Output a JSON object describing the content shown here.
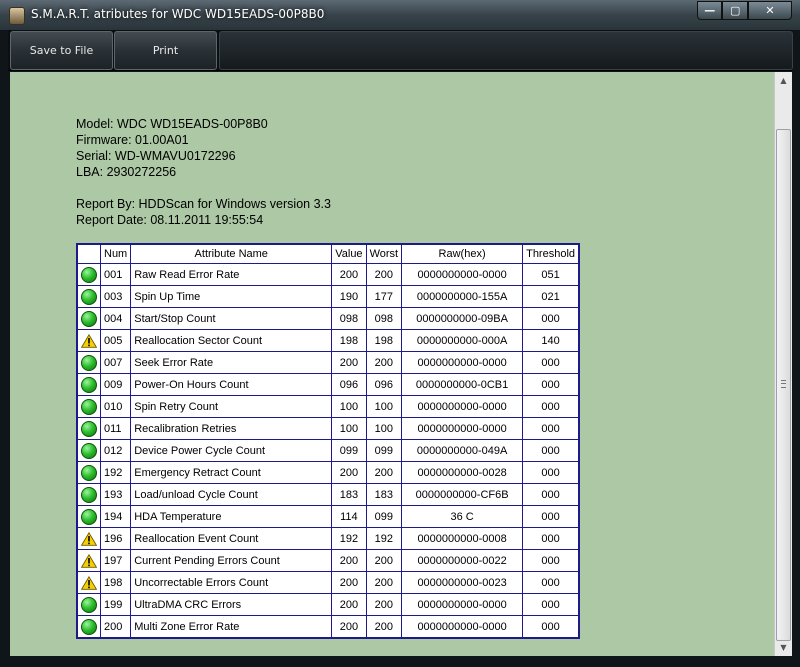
{
  "window": {
    "title": "S.M.A.R.T. atributes for WDC WD15EADS-00P8B0"
  },
  "toolbar": {
    "save_label": "Save to File",
    "print_label": "Print"
  },
  "info": {
    "model": "Model: WDC WD15EADS-00P8B0",
    "firmware": "Firmware: 01.00A01",
    "serial": "Serial: WD-WMAVU0172296",
    "lba": "LBA: 2930272256",
    "report_by": "Report By: HDDScan for Windows version 3.3",
    "report_date": "Report Date: 08.11.2011 19:55:54"
  },
  "table": {
    "headers": {
      "num": "Num",
      "name": "Attribute Name",
      "value": "Value",
      "worst": "Worst",
      "raw": "Raw(hex)",
      "threshold": "Threshold"
    },
    "rows": [
      {
        "status": "ok",
        "num": "001",
        "name": "Raw Read Error Rate",
        "value": "200",
        "worst": "200",
        "raw": "0000000000-0000",
        "threshold": "051"
      },
      {
        "status": "ok",
        "num": "003",
        "name": "Spin Up Time",
        "value": "190",
        "worst": "177",
        "raw": "0000000000-155A",
        "threshold": "021"
      },
      {
        "status": "ok",
        "num": "004",
        "name": "Start/Stop Count",
        "value": "098",
        "worst": "098",
        "raw": "0000000000-09BA",
        "threshold": "000"
      },
      {
        "status": "warning",
        "num": "005",
        "name": "Reallocation Sector Count",
        "value": "198",
        "worst": "198",
        "raw": "0000000000-000A",
        "threshold": "140"
      },
      {
        "status": "ok",
        "num": "007",
        "name": "Seek Error Rate",
        "value": "200",
        "worst": "200",
        "raw": "0000000000-0000",
        "threshold": "000"
      },
      {
        "status": "ok",
        "num": "009",
        "name": "Power-On Hours Count",
        "value": "096",
        "worst": "096",
        "raw": "0000000000-0CB1",
        "threshold": "000"
      },
      {
        "status": "ok",
        "num": "010",
        "name": "Spin Retry Count",
        "value": "100",
        "worst": "100",
        "raw": "0000000000-0000",
        "threshold": "000"
      },
      {
        "status": "ok",
        "num": "011",
        "name": "Recalibration Retries",
        "value": "100",
        "worst": "100",
        "raw": "0000000000-0000",
        "threshold": "000"
      },
      {
        "status": "ok",
        "num": "012",
        "name": "Device Power Cycle Count",
        "value": "099",
        "worst": "099",
        "raw": "0000000000-049A",
        "threshold": "000"
      },
      {
        "status": "ok",
        "num": "192",
        "name": "Emergency Retract Count",
        "value": "200",
        "worst": "200",
        "raw": "0000000000-0028",
        "threshold": "000"
      },
      {
        "status": "ok",
        "num": "193",
        "name": "Load/unload Cycle Count",
        "value": "183",
        "worst": "183",
        "raw": "0000000000-CF6B",
        "threshold": "000"
      },
      {
        "status": "ok",
        "num": "194",
        "name": "HDA Temperature",
        "value": "114",
        "worst": "099",
        "raw": "36 C",
        "threshold": "000"
      },
      {
        "status": "warning",
        "num": "196",
        "name": "Reallocation Event Count",
        "value": "192",
        "worst": "192",
        "raw": "0000000000-0008",
        "threshold": "000"
      },
      {
        "status": "warning",
        "num": "197",
        "name": "Current Pending Errors Count",
        "value": "200",
        "worst": "200",
        "raw": "0000000000-0022",
        "threshold": "000"
      },
      {
        "status": "warning",
        "num": "198",
        "name": "Uncorrectable Errors Count",
        "value": "200",
        "worst": "200",
        "raw": "0000000000-0023",
        "threshold": "000"
      },
      {
        "status": "ok",
        "num": "199",
        "name": "UltraDMA CRC Errors",
        "value": "200",
        "worst": "200",
        "raw": "0000000000-0000",
        "threshold": "000"
      },
      {
        "status": "ok",
        "num": "200",
        "name": "Multi Zone Error Rate",
        "value": "200",
        "worst": "200",
        "raw": "0000000000-0000",
        "threshold": "000"
      }
    ]
  },
  "icons": {
    "ok": "green-status-icon",
    "warning": "warning-triangle-icon"
  }
}
